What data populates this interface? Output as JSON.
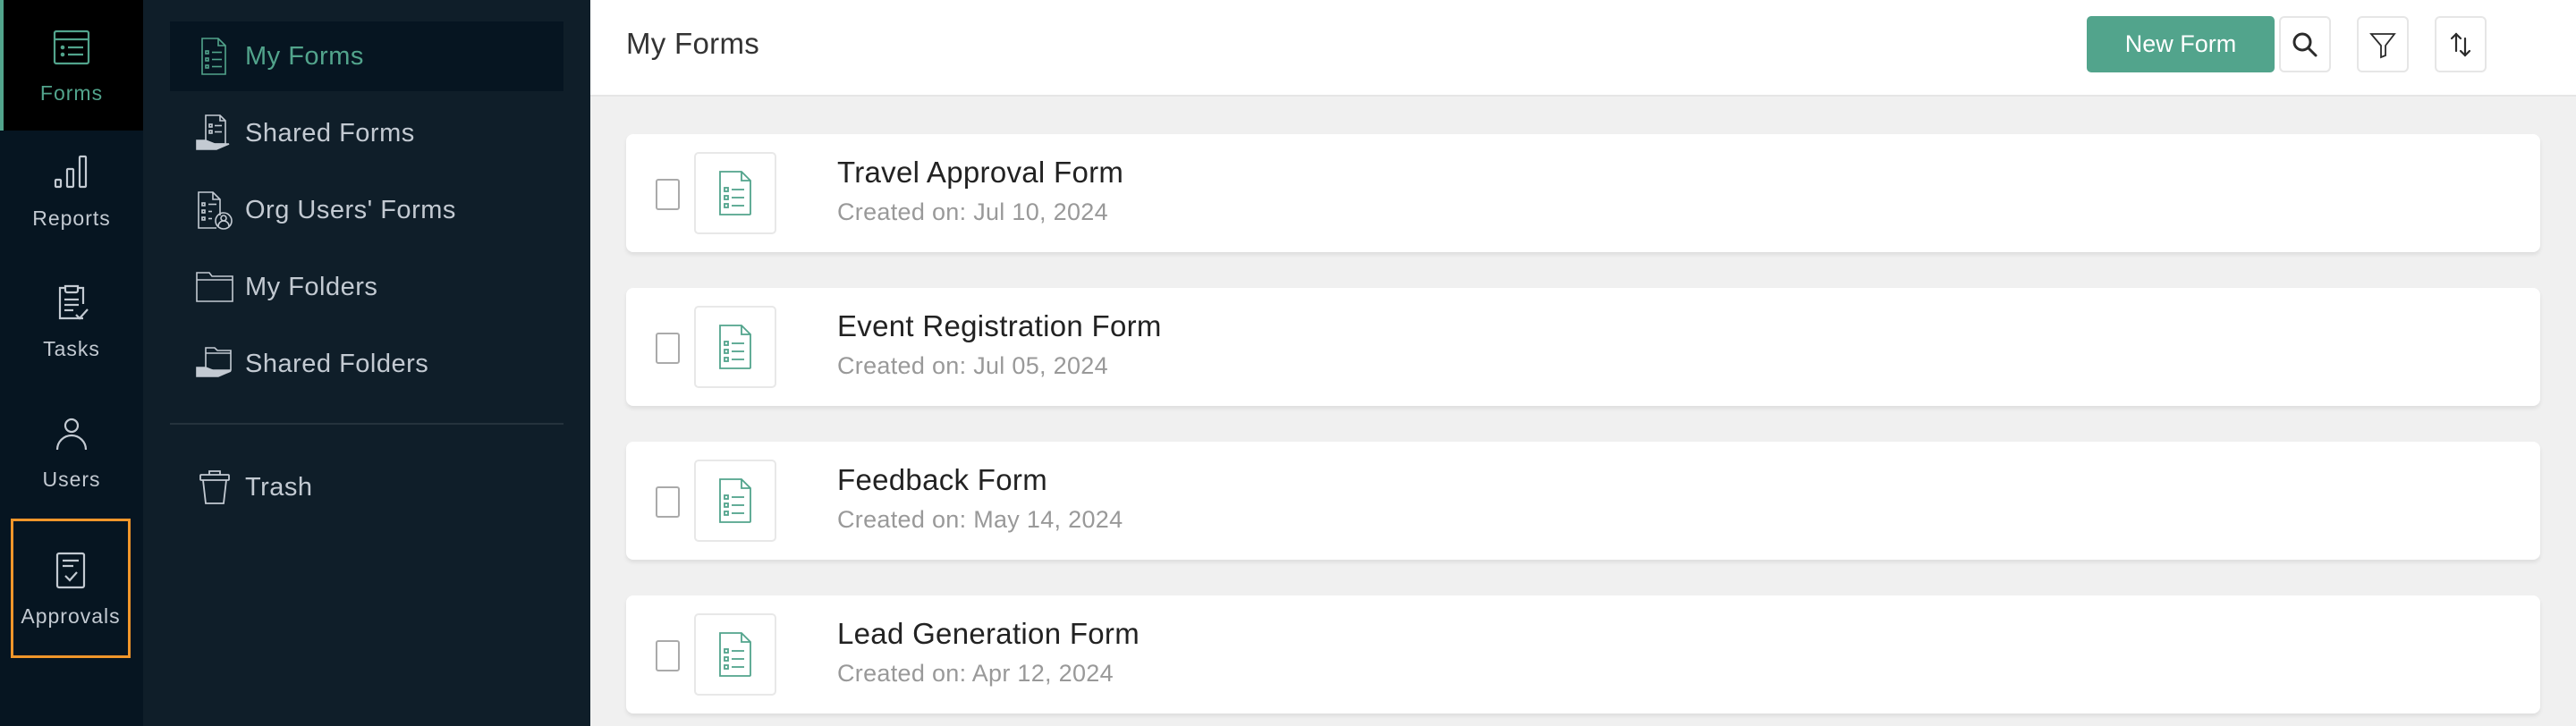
{
  "colors": {
    "accent": "#52a48c",
    "highlight": "#f0962a",
    "rail_bg": "#061521",
    "sidebar_bg": "#0f1e29"
  },
  "rail": {
    "items": [
      {
        "label": "Forms",
        "icon": "form-list-icon",
        "active": true
      },
      {
        "label": "Reports",
        "icon": "bar-chart-icon"
      },
      {
        "label": "Tasks",
        "icon": "clipboard-check-icon"
      },
      {
        "label": "Users",
        "icon": "user-icon"
      },
      {
        "label": "Approvals",
        "icon": "approval-document-icon",
        "highlighted": true
      }
    ]
  },
  "sidebar": {
    "items": [
      {
        "label": "My Forms",
        "icon": "form-document-icon",
        "active": true
      },
      {
        "label": "Shared Forms",
        "icon": "shared-form-icon"
      },
      {
        "label": "Org Users' Forms",
        "icon": "org-user-form-icon"
      },
      {
        "label": "My Folders",
        "icon": "folder-icon"
      },
      {
        "label": "Shared Folders",
        "icon": "shared-folder-icon"
      },
      {
        "label": "Trash",
        "icon": "trash-icon"
      }
    ]
  },
  "header": {
    "title": "My Forms",
    "new_form_label": "New Form",
    "search_icon": "search-icon",
    "filter_icon": "filter-icon",
    "sort_icon": "sort-icon"
  },
  "forms": [
    {
      "title": "Travel Approval Form",
      "created": "Created on: Jul 10, 2024"
    },
    {
      "title": "Event Registration Form",
      "created": "Created on: Jul 05, 2024"
    },
    {
      "title": "Feedback Form",
      "created": "Created on: May 14, 2024"
    },
    {
      "title": "Lead Generation Form",
      "created": "Created on: Apr 12, 2024"
    }
  ]
}
